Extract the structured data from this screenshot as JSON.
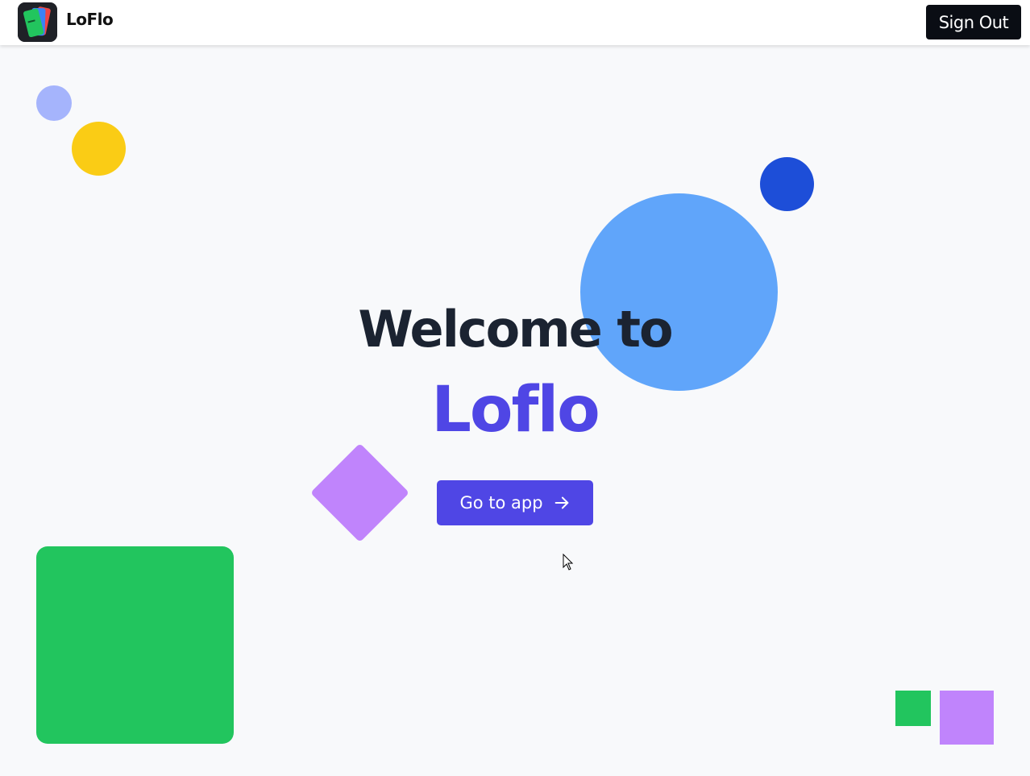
{
  "navbar": {
    "brand_name": "LoFlo",
    "logo_icon": "loflo-cards-logo-icon",
    "signout_label": "Sign Out"
  },
  "hero": {
    "title_line1": "Welcome to",
    "title_line2": "Loflo",
    "cta_label": "Go to app",
    "cta_icon": "arrow-right-icon"
  },
  "colors": {
    "accent": "#4f46e5",
    "dark": "#1b2331",
    "background": "#f8f9fb",
    "navbar_button": "#0a0d14",
    "shape_light_indigo": "#a5b4fc",
    "shape_yellow": "#facc15",
    "shape_blue": "#60a5fa",
    "shape_dark_blue": "#1d4ed8",
    "shape_purple": "#c084fc",
    "shape_green": "#22c55e"
  }
}
